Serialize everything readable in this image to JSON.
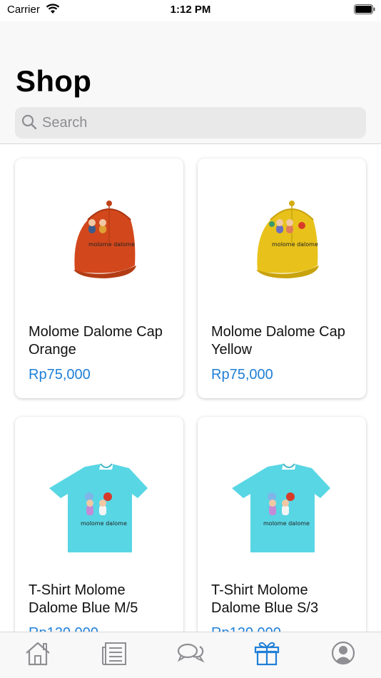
{
  "status_bar": {
    "carrier": "Carrier",
    "time": "1:12 PM"
  },
  "header": {
    "title": "Shop"
  },
  "search": {
    "placeholder": "Search"
  },
  "products": [
    {
      "name": "Molome Dalome Cap Orange",
      "price": "Rp75,000",
      "image": "orange-cap"
    },
    {
      "name": "Molome Dalome Cap Yellow",
      "price": "Rp75,000",
      "image": "yellow-cap"
    },
    {
      "name": "T-Shirt Molome Dalome Blue M/5",
      "price": "Rp120,000",
      "image": "blue-tshirt"
    },
    {
      "name": "T-Shirt Molome Dalome Blue S/3",
      "price": "Rp120,000",
      "image": "blue-tshirt"
    }
  ],
  "tab_bar": {
    "items": [
      {
        "icon": "home-icon",
        "active": false
      },
      {
        "icon": "news-icon",
        "active": false
      },
      {
        "icon": "chat-icon",
        "active": false
      },
      {
        "icon": "gift-icon",
        "active": true
      },
      {
        "icon": "profile-icon",
        "active": false
      }
    ]
  },
  "colors": {
    "accent": "#1f7fd8",
    "inactive": "#8e8e93",
    "price": "#1f7fd8"
  }
}
